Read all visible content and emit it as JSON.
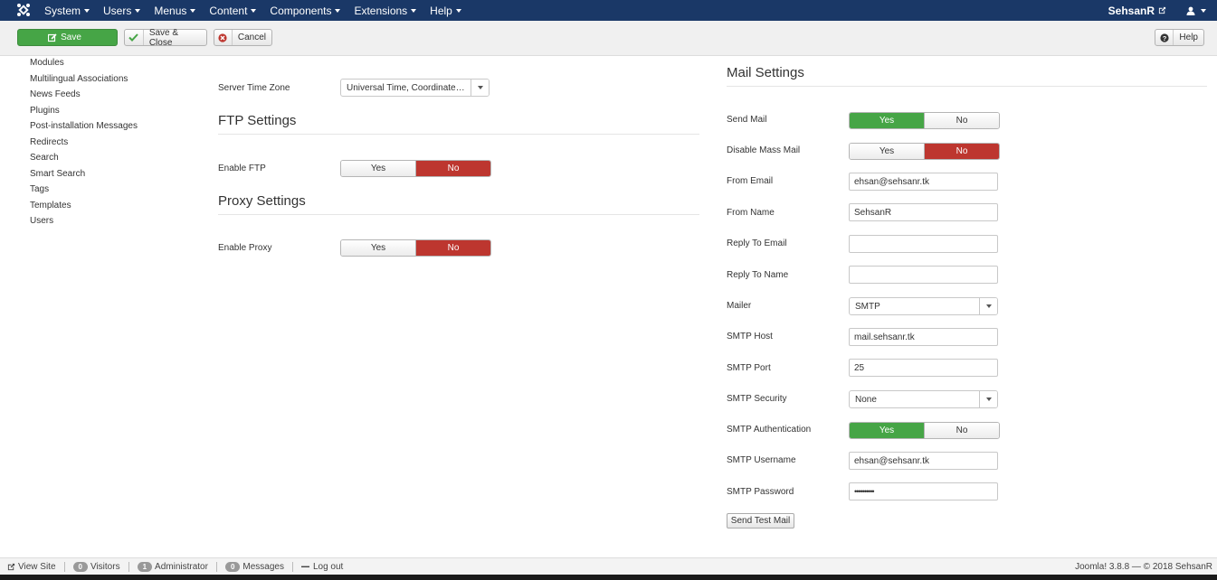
{
  "navbar": {
    "menus": [
      "System",
      "Users",
      "Menus",
      "Content",
      "Components",
      "Extensions",
      "Help"
    ],
    "user_name": "SehsanR"
  },
  "toolbar": {
    "save": "Save",
    "save_close": "Save & Close",
    "cancel": "Cancel",
    "help": "Help"
  },
  "sidebar": {
    "items": [
      "Modules",
      "Multilingual Associations",
      "News Feeds",
      "Plugins",
      "Post-installation Messages",
      "Redirects",
      "Search",
      "Smart Search",
      "Tags",
      "Templates",
      "Users"
    ]
  },
  "server": {
    "timezone_label": "Server Time Zone",
    "timezone_value": "Universal Time, Coordinated (UTC)"
  },
  "ftp": {
    "title": "FTP Settings",
    "enable_label": "Enable FTP",
    "yes": "Yes",
    "no": "No",
    "value": "No"
  },
  "proxy": {
    "title": "Proxy Settings",
    "enable_label": "Enable Proxy",
    "yes": "Yes",
    "no": "No",
    "value": "No"
  },
  "mail": {
    "title": "Mail Settings",
    "send_mail": {
      "label": "Send Mail",
      "yes": "Yes",
      "no": "No",
      "value": "Yes"
    },
    "disable_mass": {
      "label": "Disable Mass Mail",
      "yes": "Yes",
      "no": "No",
      "value": "No"
    },
    "from_email": {
      "label": "From Email",
      "value": "ehsan@sehsanr.tk"
    },
    "from_name": {
      "label": "From Name",
      "value": "SehsanR"
    },
    "reply_email": {
      "label": "Reply To Email",
      "value": ""
    },
    "reply_name": {
      "label": "Reply To Name",
      "value": ""
    },
    "mailer": {
      "label": "Mailer",
      "value": "SMTP"
    },
    "smtp_host": {
      "label": "SMTP Host",
      "value": "mail.sehsanr.tk"
    },
    "smtp_port": {
      "label": "SMTP Port",
      "value": "25"
    },
    "smtp_security": {
      "label": "SMTP Security",
      "value": "None"
    },
    "smtp_auth": {
      "label": "SMTP Authentication",
      "yes": "Yes",
      "no": "No",
      "value": "Yes"
    },
    "smtp_user": {
      "label": "SMTP Username",
      "value": "ehsan@sehsanr.tk"
    },
    "smtp_pass": {
      "label": "SMTP Password",
      "value": "••••••••••"
    },
    "test_button": "Send Test Mail"
  },
  "statusbar": {
    "view_site": "View Site",
    "visitors_count": "0",
    "visitors": "Visitors",
    "admin_count": "1",
    "admin": "Administrator",
    "messages_count": "0",
    "messages": "Messages",
    "logout": "Log out",
    "version": "Joomla! 3.8.8 — © 2018 SehsanR"
  },
  "colors": {
    "navbar": "#1a3867",
    "save_green": "#46a546",
    "toggle_red": "#bd362f"
  }
}
